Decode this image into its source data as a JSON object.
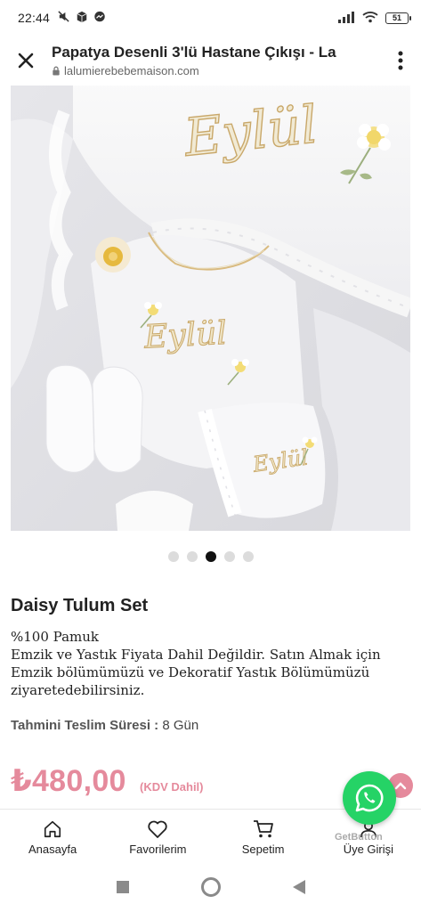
{
  "status_bar": {
    "time": "22:44",
    "battery": "51",
    "icons": [
      "mute-icon",
      "package-icon",
      "messenger-icon",
      "signal-icon",
      "wifi-icon",
      "battery-icon"
    ]
  },
  "browser": {
    "title": "Papatya Desenli 3'lü Hastane Çıkışı - La",
    "domain": "lalumierebebemaison.com"
  },
  "carousel": {
    "count": 5,
    "active_index": 2,
    "embroidery_text": "Eylül"
  },
  "product": {
    "title": "Daisy Tulum Set",
    "description_lines": [
      "%100 Pamuk",
      "Emzik ve Yastık Fiyata Dahil Değildir. Satın Almak için Emzik bölümümüzü ve Dekoratif Yastık Bölümümüzü ziyaretedebilirsiniz."
    ],
    "delivery_label": "Tahmini Teslim Süresi :",
    "delivery_value": "8 Gün",
    "price": "₺480,00",
    "vat_note": "(KDV Dahil)"
  },
  "floating": {
    "getbutton_label": "GetButton"
  },
  "bottom_nav": {
    "items": [
      {
        "label": "Anasayfa",
        "icon": "home-icon"
      },
      {
        "label": "Favorilerim",
        "icon": "heart-icon"
      },
      {
        "label": "Sepetim",
        "icon": "cart-icon"
      },
      {
        "label": "Üye Girişi",
        "icon": "user-icon"
      }
    ]
  },
  "colors": {
    "price": "#e58a9c",
    "whatsapp": "#25d366",
    "active_dot": "#111111"
  }
}
